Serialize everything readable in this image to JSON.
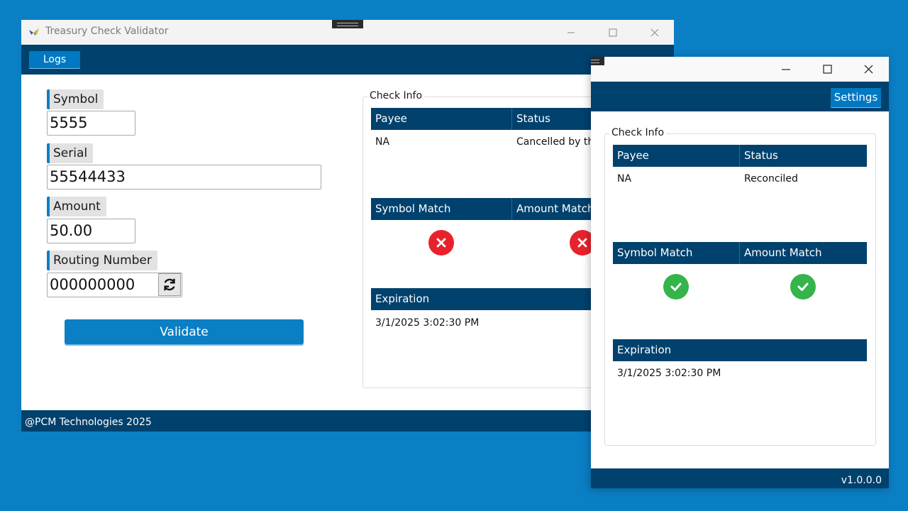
{
  "main_window": {
    "title": "Treasury Check Validator",
    "nav": {
      "logs_label": "Logs"
    },
    "form": {
      "symbol_label": "Symbol",
      "symbol_value": "5555",
      "serial_label": "Serial",
      "serial_value": "55544433",
      "amount_label": "Amount",
      "amount_value": "50.00",
      "routing_label": "Routing Number",
      "routing_value": "000000000",
      "validate_label": "Validate"
    },
    "check_info": {
      "title": "Check Info",
      "payee_header": "Payee",
      "status_header": "Status",
      "payee_value": "NA",
      "status_value": "Cancelled by the",
      "symbol_match_header": "Symbol Match",
      "amount_match_header": "Amount Match",
      "symbol_match": "fail",
      "amount_match": "fail",
      "expiration_header": "Expiration",
      "expiration_value": "3/1/2025 3:02:30 PM"
    },
    "footer": "@PCM Technologies 2025"
  },
  "second_window": {
    "nav": {
      "settings_label": "Settings"
    },
    "check_info": {
      "title": "Check Info",
      "payee_header": "Payee",
      "status_header": "Status",
      "payee_value": "NA",
      "status_value": "Reconciled",
      "symbol_match_header": "Symbol Match",
      "amount_match_header": "Amount Match",
      "symbol_match": "pass",
      "amount_match": "pass",
      "expiration_header": "Expiration",
      "expiration_value": "3/1/2025 3:02:30 PM"
    },
    "version": "v1.0.0.0"
  },
  "colors": {
    "desktop": "#0a7fc4",
    "navbar": "#00416d",
    "accent": "#0a7fc4",
    "fail": "#e8222c",
    "pass": "#34b44a"
  },
  "icons": {
    "app": "app-logo-icon",
    "minimize": "minimize-icon",
    "maximize": "maximize-icon",
    "close": "close-icon",
    "refresh": "refresh-icon",
    "fail": "x-circle-icon",
    "pass": "check-circle-icon"
  }
}
